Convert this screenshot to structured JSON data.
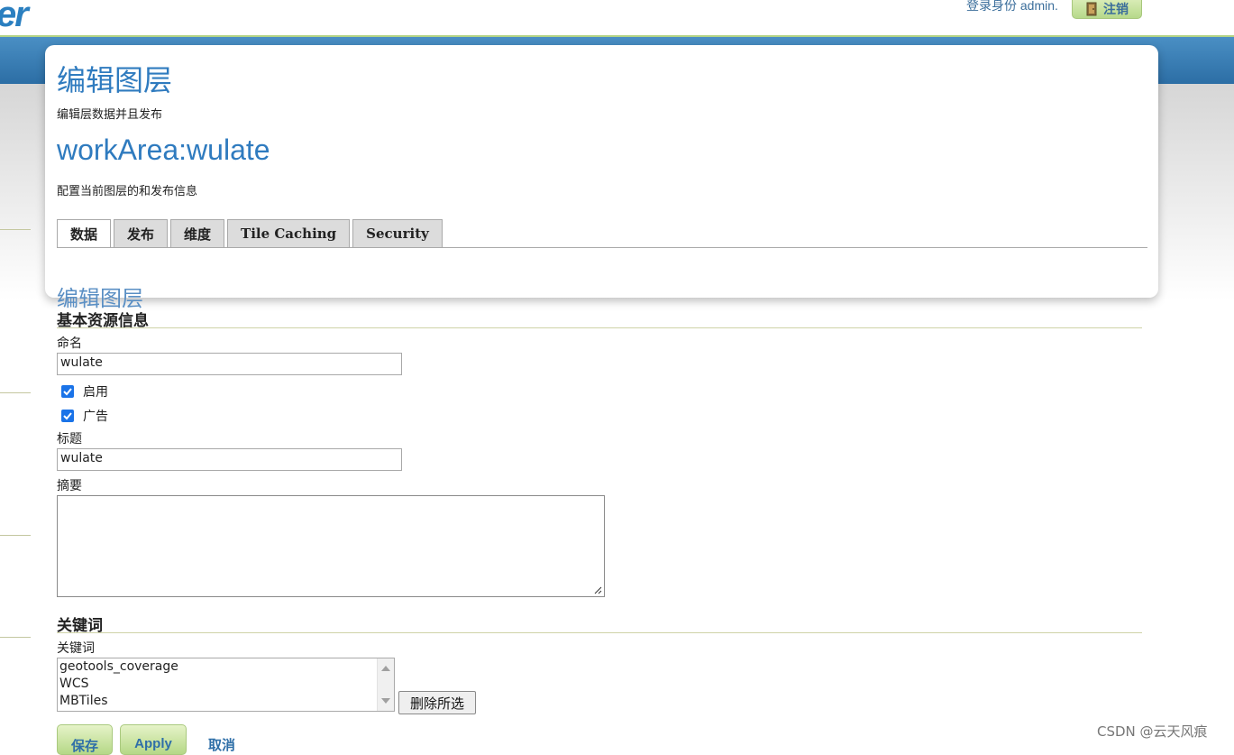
{
  "header": {
    "logo_text": "er",
    "login_text": "登录身份 admin.",
    "logout_label": "注销"
  },
  "page": {
    "title": "编辑图层",
    "description": "编辑层数据并且发布",
    "layer_title": "workArea:wulate",
    "layer_description": "配置当前图层的和发布信息"
  },
  "tabs": [
    {
      "label": "数据",
      "active": true
    },
    {
      "label": "发布",
      "active": false
    },
    {
      "label": "维度",
      "active": false
    },
    {
      "label": "Tile Caching",
      "active": false
    },
    {
      "label": "Security",
      "active": false
    }
  ],
  "form": {
    "title": "编辑图层",
    "basic_section": "基本资源信息",
    "name_label": "命名",
    "name_value": "wulate",
    "enabled_label": "启用",
    "enabled_checked": true,
    "advertised_label": "广告",
    "advertised_checked": true,
    "title_label": "标题",
    "title_value": "wulate",
    "abstract_label": "摘要",
    "keywords_section": "关键词",
    "keywords_label": "关键词",
    "keywords": [
      "geotools_coverage",
      "WCS",
      "MBTiles"
    ],
    "delete_selected_label": "删除所选"
  },
  "actions": {
    "save_label": "保存",
    "apply_label": "Apply",
    "cancel_label": "取消"
  },
  "watermark": "CSDN @云天风痕",
  "colors": {
    "accent_blue": "#2f7bbf",
    "button_green": "#b5d887",
    "checkbox_blue": "#1a73e8"
  }
}
